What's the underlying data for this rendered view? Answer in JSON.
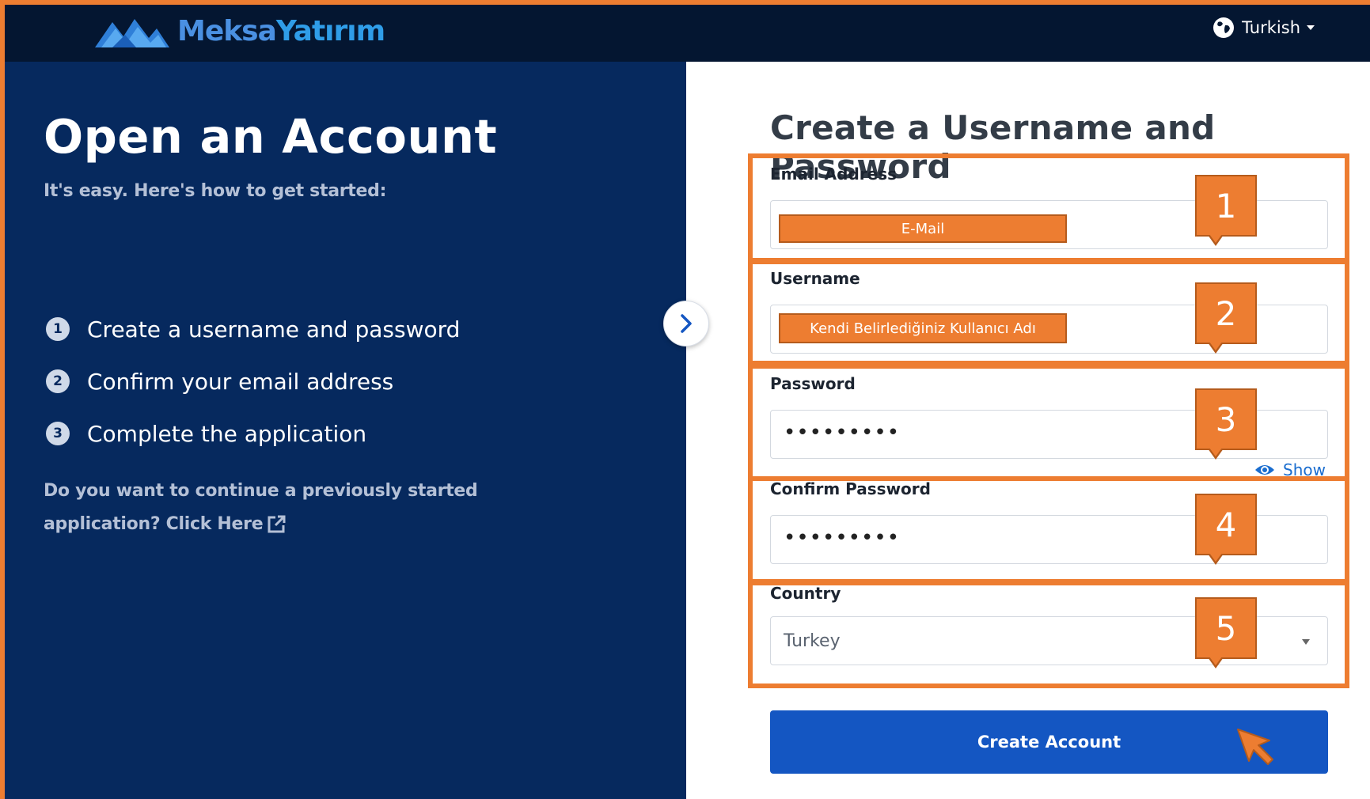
{
  "header": {
    "logo_part1": "Meksa",
    "logo_part2": "Yatırım",
    "language": "Turkish",
    "language_icon": "globe-icon"
  },
  "left": {
    "title": "Open an Account",
    "subtitle": "It's easy. Here's how to get started:",
    "steps": [
      {
        "num": "1",
        "label": "Create a username and password"
      },
      {
        "num": "2",
        "label": "Confirm your email address"
      },
      {
        "num": "3",
        "label": "Complete the application"
      }
    ],
    "continue_text": "Do you want to continue a previously started application?",
    "click_here": "Click Here",
    "toggle_icon": "chevron-right-icon"
  },
  "form": {
    "title": "Create a Username and Password",
    "email_label": "Email Address",
    "email_value": "E-Mail",
    "username_label": "Username",
    "username_value": "Kendi Belirlediğiniz Kullanıcı Adı",
    "password_label": "Password",
    "password_value": "•••••••••",
    "show_label": "Show",
    "confirm_label": "Confirm Password",
    "confirm_value": "•••••••••",
    "country_label": "Country",
    "country_value": "Turkey",
    "submit_label": "Create Account"
  },
  "annotations": {
    "callouts": [
      "1",
      "2",
      "3",
      "4",
      "5"
    ],
    "highlight_color": "#ed7d31"
  }
}
